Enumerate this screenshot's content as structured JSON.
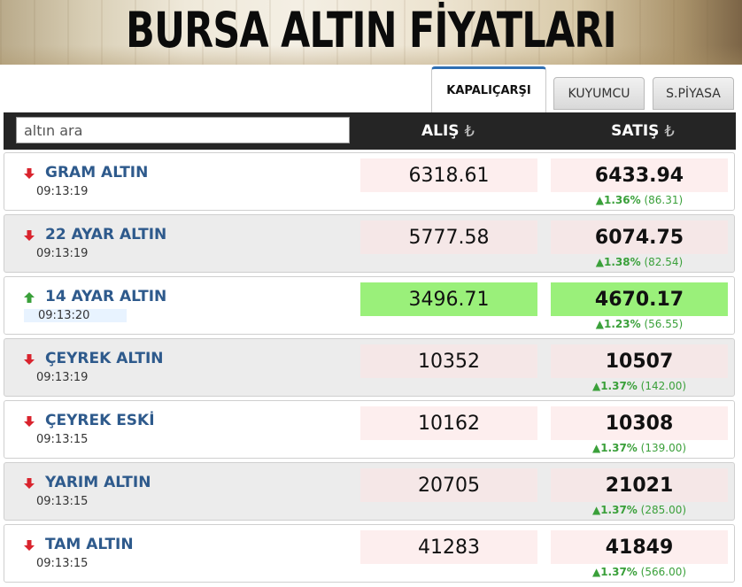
{
  "banner": {
    "title": "BURSA ALTIN FİYATLARI"
  },
  "tabs": [
    {
      "label": "KAPALIÇARŞI",
      "active": true
    },
    {
      "label": "KUYUMCU",
      "active": false
    },
    {
      "label": "S.PİYASA",
      "active": false
    }
  ],
  "search": {
    "placeholder": "altın ara"
  },
  "columns": {
    "alis": "ALIŞ",
    "satis": "SATIŞ",
    "currency_symbol": "₺"
  },
  "colors": {
    "header_bg": "#252525",
    "name_blue": "#2e5a8c",
    "up_green": "#3aa03a",
    "down_red": "#d9232d",
    "highlight_green": "#9af07a",
    "tab_accent": "#2f6fb3"
  },
  "rows": [
    {
      "name": "GRAM ALTIN",
      "time": "09:13:19",
      "direction": "down",
      "alis": "6318.61",
      "satis": "6433.94",
      "change_arrow": "▲",
      "change_pct": "1.36%",
      "change_abs": "(86.31)"
    },
    {
      "name": "22 AYAR ALTIN",
      "time": "09:13:19",
      "direction": "down",
      "alis": "5777.58",
      "satis": "6074.75",
      "change_arrow": "▲",
      "change_pct": "1.38%",
      "change_abs": "(82.54)"
    },
    {
      "name": "14 AYAR ALTIN",
      "time": "09:13:20",
      "direction": "up",
      "alis": "3496.71",
      "satis": "4670.17",
      "change_arrow": "▲",
      "change_pct": "1.23%",
      "change_abs": "(56.55)"
    },
    {
      "name": "ÇEYREK ALTIN",
      "time": "09:13:19",
      "direction": "down",
      "alis": "10352",
      "satis": "10507",
      "change_arrow": "▲",
      "change_pct": "1.37%",
      "change_abs": "(142.00)"
    },
    {
      "name": "ÇEYREK ESKİ",
      "time": "09:13:15",
      "direction": "down",
      "alis": "10162",
      "satis": "10308",
      "change_arrow": "▲",
      "change_pct": "1.37%",
      "change_abs": "(139.00)"
    },
    {
      "name": "YARIM ALTIN",
      "time": "09:13:15",
      "direction": "down",
      "alis": "20705",
      "satis": "21021",
      "change_arrow": "▲",
      "change_pct": "1.37%",
      "change_abs": "(285.00)"
    },
    {
      "name": "TAM ALTIN",
      "time": "09:13:15",
      "direction": "down",
      "alis": "41283",
      "satis": "41849",
      "change_arrow": "▲",
      "change_pct": "1.37%",
      "change_abs": "(566.00)"
    }
  ]
}
